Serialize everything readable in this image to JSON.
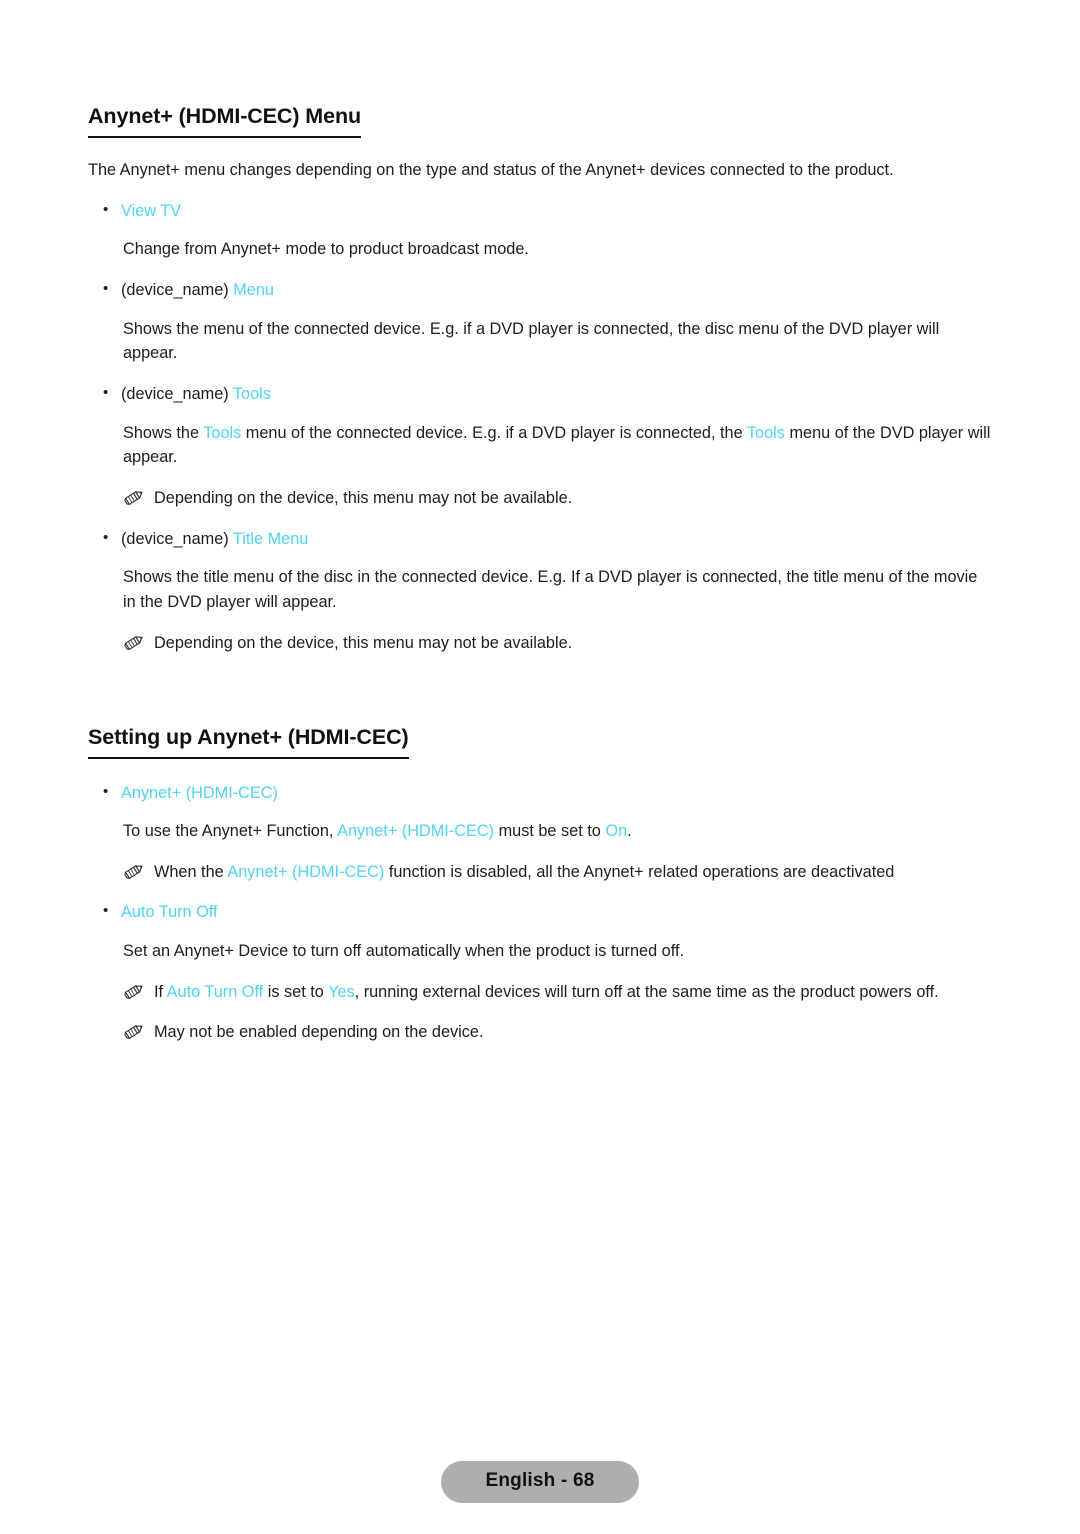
{
  "document": {
    "language": "English",
    "page_number": "68",
    "footer_label": "English - 68"
  },
  "colors": {
    "highlight_cyan": "#4fd4f2",
    "text": "#1d1d1d",
    "heading": "#111111",
    "footer_pill_bg": "#aeaeae"
  },
  "sections": [
    {
      "heading": "Anynet+ (HDMI-CEC) Menu",
      "intro": "The Anynet+ menu changes depending on the type and status of the Anynet+ devices connected to the product.",
      "items": [
        {
          "bullet_plain": "",
          "bullet_highlight": "View TV",
          "description_pre": "Change from Anynet+ mode to product broadcast mode.",
          "notes": []
        },
        {
          "bullet_plain": "(device_name) ",
          "bullet_highlight": "Menu",
          "description_pre": "Shows the menu of the connected device. E.g. if a DVD player is connected, the disc menu of the DVD player will appear.",
          "notes": []
        },
        {
          "bullet_plain": "(device_name) ",
          "bullet_highlight": "Tools",
          "desc_part1": "Shows the ",
          "desc_hl1": "Tools",
          "desc_part2": " menu of the connected device. E.g. if a DVD player is connected, the ",
          "desc_hl2": "Tools",
          "desc_part3": " menu of the DVD player will appear.",
          "notes": [
            "Depending on the device, this menu may not be available."
          ]
        },
        {
          "bullet_plain": "(device_name) ",
          "bullet_highlight": "Title Menu",
          "description_pre": "Shows the title menu of the disc in the connected device. E.g. If a DVD player is connected, the title menu of the movie in the DVD player will appear.",
          "notes": [
            "Depending on the device, this menu may not be available."
          ]
        }
      ]
    },
    {
      "heading": "Setting up Anynet+ (HDMI-CEC)",
      "items": [
        {
          "bullet_highlight": "Anynet+ (HDMI-CEC)",
          "desc_part1": "To use the Anynet+ Function, ",
          "desc_hl1": "Anynet+ (HDMI-CEC)",
          "desc_part2": " must be set to ",
          "desc_hl2": "On",
          "desc_part3": ".",
          "note_part1": "When the ",
          "note_hl1": "Anynet+ (HDMI-CEC)",
          "note_part2": " function is disabled, all the Anynet+ related operations are deactivated"
        },
        {
          "bullet_highlight": "Auto Turn Off",
          "description_pre": "Set an Anynet+ Device to turn off automatically when the product is turned off.",
          "note_part1": "If ",
          "note_hl1": "Auto Turn Off",
          "note_part2": " is set to ",
          "note_hl2": "Yes",
          "note_part3": ", running external devices will turn off at the same time as the product powers off.",
          "note2": "May not be enabled depending on the device."
        }
      ]
    }
  ],
  "icons": {
    "bullet": "•",
    "note": "pencil-icon"
  }
}
